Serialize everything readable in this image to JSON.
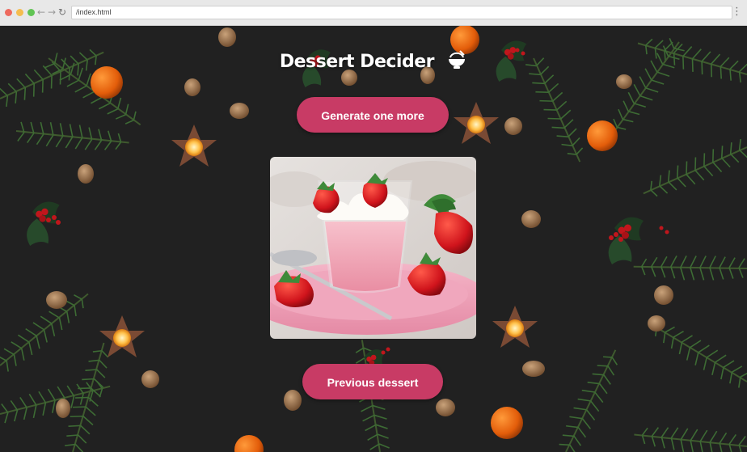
{
  "browser": {
    "url": "/index.html",
    "nav": {
      "back": "←",
      "forward": "→",
      "reload": "↻"
    },
    "menu": "⋮"
  },
  "page": {
    "title": "Dessert Decider",
    "title_icon": "bowl-icon",
    "generate_label": "Generate one more",
    "previous_label": "Previous dessert"
  },
  "image": {
    "subject": "strawberry-dessert-cup",
    "icon": "dessert-photo"
  },
  "colors": {
    "button": "#c83b65",
    "button_text": "#ffffff",
    "background": "#1c1c1c",
    "title": "#ffffff"
  }
}
